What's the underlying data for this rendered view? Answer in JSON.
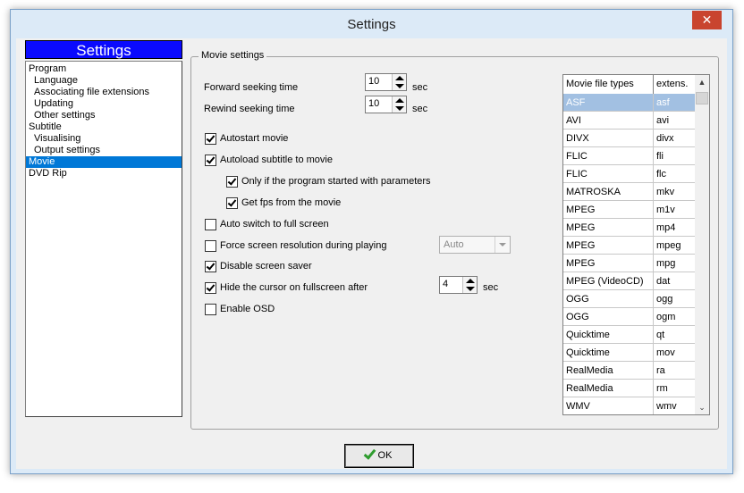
{
  "window": {
    "title": "Settings",
    "close_glyph": "✕"
  },
  "panel": {
    "header": "Settings"
  },
  "tree": [
    {
      "label": "Program",
      "level": 0
    },
    {
      "label": "Language",
      "level": 1
    },
    {
      "label": "Associating file extensions",
      "level": 1
    },
    {
      "label": "Updating",
      "level": 1
    },
    {
      "label": "Other settings",
      "level": 1
    },
    {
      "label": "Subtitle",
      "level": 0
    },
    {
      "label": "Visualising",
      "level": 1
    },
    {
      "label": "Output settings",
      "level": 1
    },
    {
      "label": "Movie",
      "level": 0,
      "selected": true
    },
    {
      "label": "DVD Rip",
      "level": 0
    }
  ],
  "movie": {
    "group_label": "Movie settings",
    "forward_label": "Forward seeking time",
    "forward_value": "10",
    "rewind_label": "Rewind seeking time",
    "rewind_value": "10",
    "unit_sec": "sec",
    "autostart": "Autostart movie",
    "autoload": "Autoload subtitle to movie",
    "only_if": "Only if the program started with parameters",
    "get_fps": "Get fps from the movie",
    "auto_full": "Auto switch to full screen",
    "force_res": "Force screen resolution during playing",
    "res_value": "Auto",
    "disable_saver": "Disable screen saver",
    "hide_cursor": "Hide the cursor on fullscreen after",
    "hide_value": "4",
    "enable_osd": "Enable OSD"
  },
  "checks": {
    "autostart": true,
    "autoload": true,
    "only_if": true,
    "get_fps": true,
    "auto_full": false,
    "force_res": false,
    "disable_saver": true,
    "hide_cursor": true,
    "enable_osd": false
  },
  "table": {
    "col1": "Movie file types",
    "col2": "extens.",
    "rows": [
      [
        "ASF",
        "asf"
      ],
      [
        "AVI",
        "avi"
      ],
      [
        "DIVX",
        "divx"
      ],
      [
        "FLIC",
        "fli"
      ],
      [
        "FLIC",
        "flc"
      ],
      [
        "MATROSKA",
        "mkv"
      ],
      [
        "MPEG",
        "m1v"
      ],
      [
        "MPEG",
        "mp4"
      ],
      [
        "MPEG",
        "mpeg"
      ],
      [
        "MPEG",
        "mpg"
      ],
      [
        "MPEG (VideoCD)",
        "dat"
      ],
      [
        "OGG",
        "ogg"
      ],
      [
        "OGG",
        "ogm"
      ],
      [
        "Quicktime",
        "qt"
      ],
      [
        "Quicktime",
        "mov"
      ],
      [
        "RealMedia",
        "ra"
      ],
      [
        "RealMedia",
        "rm"
      ],
      [
        "WMV",
        "wmv"
      ]
    ],
    "selected_index": 0
  },
  "buttons": {
    "ok": "OK"
  }
}
